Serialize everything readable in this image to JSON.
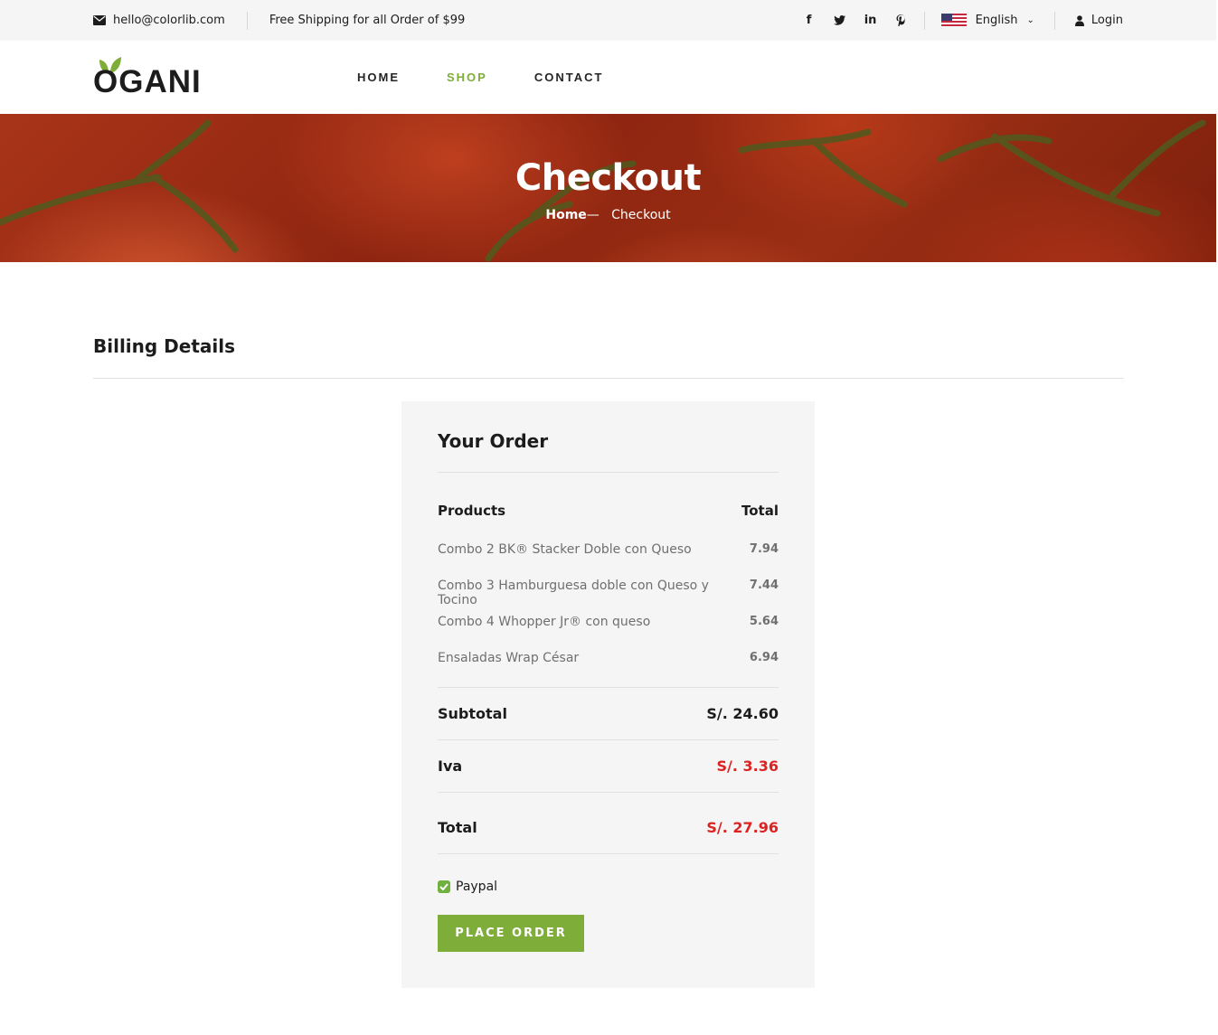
{
  "topbar": {
    "email": "hello@colorlib.com",
    "shipping": "Free Shipping for all Order of $99",
    "social": [
      "facebook-icon",
      "twitter-icon",
      "linkedin-icon",
      "pinterest-icon"
    ],
    "language": "English",
    "login": "Login"
  },
  "header": {
    "logo": "OGANI",
    "nav": [
      {
        "label": "HOME",
        "active": false
      },
      {
        "label": "SHOP",
        "active": true
      },
      {
        "label": "CONTACT",
        "active": false
      }
    ]
  },
  "hero": {
    "title": "Checkout",
    "breadcrumb_home": "Home",
    "breadcrumb_sep": "—",
    "breadcrumb_current": "Checkout"
  },
  "billing": {
    "title": "Billing Details"
  },
  "order": {
    "title": "Your Order",
    "col_products": "Products",
    "col_total": "Total",
    "items": [
      {
        "name": "Combo 2 BK® Stacker Doble con Queso",
        "price": "7.94"
      },
      {
        "name": "Combo 3 Hamburguesa doble con Queso y Tocino",
        "price": "7.44"
      },
      {
        "name": "Combo 4 Whopper Jr® con queso",
        "price": "5.64"
      },
      {
        "name": "Ensaladas Wrap César",
        "price": "6.94"
      }
    ],
    "subtotal_label": "Subtotal",
    "subtotal_value": "S/. 24.60",
    "iva_label": "Iva",
    "iva_value": "S/. 3.36",
    "total_label": "Total",
    "total_value": "S/. 27.96",
    "payment_label": "Paypal",
    "payment_checked": true,
    "place_order": "PLACE ORDER"
  },
  "colors": {
    "accent": "#7fad39",
    "price_red": "#dd2222",
    "topbar_bg": "#f5f5f5",
    "order_bg": "#f5f5f5"
  }
}
